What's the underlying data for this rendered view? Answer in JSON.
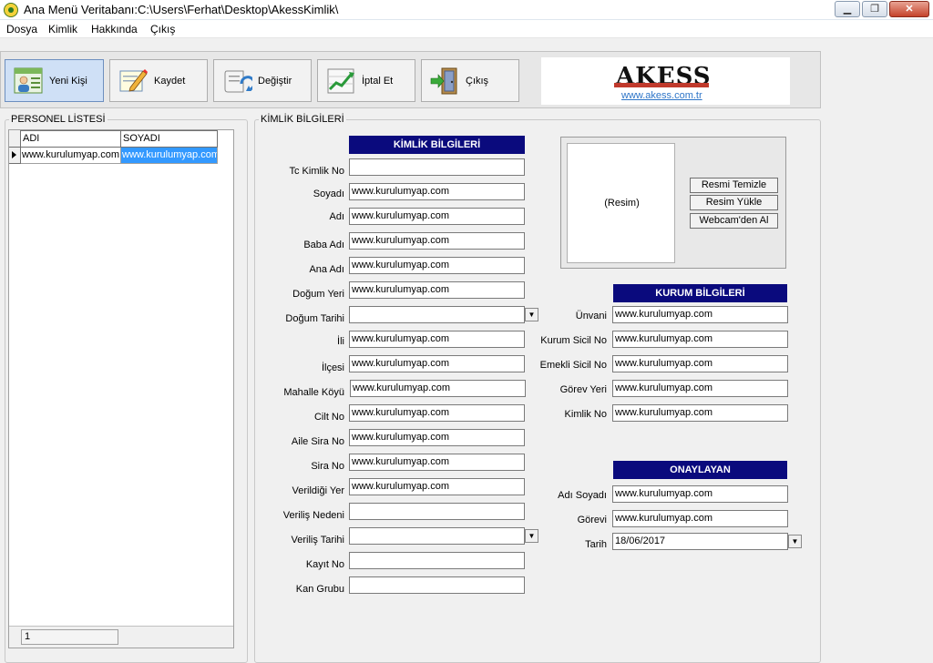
{
  "window": {
    "title": "Ana Menü Veritabanı:C:\\Users\\Ferhat\\Desktop\\AkessKimlik\\",
    "minimize": "▁",
    "maximize": "❐",
    "close": "✕"
  },
  "menu": [
    {
      "label": "Dosya"
    },
    {
      "label": "Kimlik"
    },
    {
      "label": "Hakkında"
    },
    {
      "label": "Çıkış"
    }
  ],
  "toolbar": {
    "new_label": "Yeni Kişi",
    "save_label": "Kaydet",
    "edit_label": "Değiştir",
    "cancel_label": "İptal Et",
    "exit_label": "Çıkış",
    "logo_text": "AKESS",
    "logo_url": "www.akess.com.tr"
  },
  "personel": {
    "group_label": "PERSONEL  LİSTESİ",
    "columns": [
      "ADI",
      "SOYADI"
    ],
    "rows": [
      {
        "adi": "www.kurulumyap.com",
        "soyadi": "www.kurulumyap.com"
      }
    ],
    "record_count": "1"
  },
  "kimlik": {
    "group_label": "KİMLİK BİLGİLERİ",
    "header": "KİMLİK BİLGİLERİ",
    "fields": {
      "tc": {
        "label": "Tc Kimlik No",
        "value": ""
      },
      "soyadi": {
        "label": "Soyadı",
        "value": "www.kurulumyap.com"
      },
      "adi": {
        "label": "Adı",
        "value": "www.kurulumyap.com"
      },
      "baba": {
        "label": "Baba Adı",
        "value": "www.kurulumyap.com"
      },
      "ana": {
        "label": "Ana Adı",
        "value": "www.kurulumyap.com"
      },
      "dogum_yeri": {
        "label": "Doğum Yeri",
        "value": "www.kurulumyap.com"
      },
      "dogum_tarihi": {
        "label": "Doğum Tarihi",
        "value": ""
      },
      "il": {
        "label": "İli",
        "value": "www.kurulumyap.com"
      },
      "ilce": {
        "label": "İlçesi",
        "value": "www.kurulumyap.com"
      },
      "mahalle": {
        "label": "Mahalle Köyü",
        "value": "www.kurulumyap.com"
      },
      "cilt": {
        "label": "Cilt No",
        "value": "www.kurulumyap.com"
      },
      "aile_sira": {
        "label": "Aile Sira No",
        "value": "www.kurulumyap.com"
      },
      "sira": {
        "label": "Sira No",
        "value": "www.kurulumyap.com"
      },
      "verildigi_yer": {
        "label": "Verildiği Yer",
        "value": "www.kurulumyap.com"
      },
      "verilis_nedeni": {
        "label": "Veriliş Nedeni",
        "value": ""
      },
      "verilis_tarihi": {
        "label": "Veriliş Tarihi",
        "value": ""
      },
      "kayit": {
        "label": "Kayıt No",
        "value": ""
      },
      "kan": {
        "label": "Kan Grubu",
        "value": ""
      }
    }
  },
  "photo": {
    "placeholder": "(Resim)",
    "clear": "Resmi Temizle",
    "load": "Resim Yükle",
    "webcam": "Webcam'den Al"
  },
  "kurum": {
    "header": "KURUM BİLGİLERİ",
    "fields": {
      "unvan": {
        "label": "Ünvani",
        "value": "www.kurulumyap.com"
      },
      "kurum_sicil": {
        "label": "Kurum Sicil No",
        "value": "www.kurulumyap.com"
      },
      "emekli_sicil": {
        "label": "Emekli Sicil No",
        "value": "www.kurulumyap.com"
      },
      "gorev_yeri": {
        "label": "Görev Yeri",
        "value": "www.kurulumyap.com"
      },
      "kimlik_no": {
        "label": "Kimlik No",
        "value": "www.kurulumyap.com"
      }
    }
  },
  "onaylayan": {
    "header": "ONAYLAYAN",
    "fields": {
      "adi_soyadi": {
        "label": "Adı Soyadı",
        "value": "www.kurulumyap.com"
      },
      "gorevi": {
        "label": "Görevi",
        "value": "www.kurulumyap.com"
      },
      "tarih": {
        "label": "Tarih",
        "value": "18/06/2017"
      }
    }
  },
  "colors": {
    "section_header": "#0a0a7d",
    "selection": "#3399ff",
    "link": "#2e75c8",
    "logo_accent": "#c0392b"
  },
  "icons": [
    "app-icon",
    "new-person-icon",
    "save-icon",
    "edit-icon",
    "cancel-chart-icon",
    "exit-door-icon",
    "dropdown-arrow-icon",
    "row-pointer-icon"
  ]
}
